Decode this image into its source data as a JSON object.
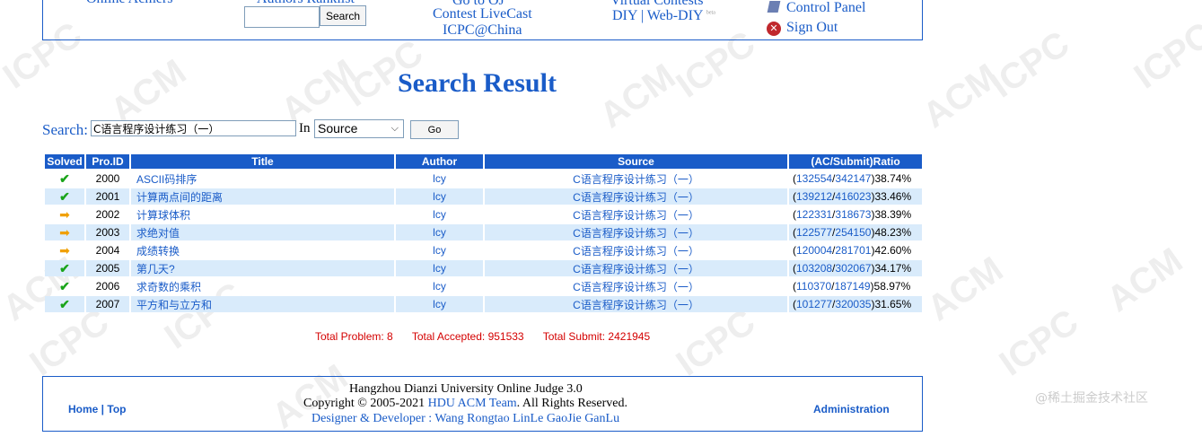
{
  "header": {
    "online_members": "Online Acmers",
    "authors_ranklist": "Authors Ranklist",
    "search_button": "Search",
    "go_to_oj": "Go to OJ",
    "contest_livecast": "Contest LiveCast",
    "icpc_china": "ICPC@China",
    "virtual_contests": "Virtual Contests",
    "diy": "DIY",
    "web_diy": "Web-DIY",
    "beta": "beta",
    "control_panel": "Control Panel",
    "sign_out": "Sign Out"
  },
  "page_title": "Search Result",
  "search": {
    "label": "Search:",
    "value": "C语言程序设计练习（一）",
    "in_label": "In",
    "field_selected": "Source",
    "go_button": "Go"
  },
  "table": {
    "columns": [
      "Solved",
      "Pro.ID",
      "Title",
      "Author",
      "Source",
      "(AC/Submit)Ratio"
    ],
    "rows": [
      {
        "status": "solved",
        "id": "2000",
        "title": "ASCII码排序",
        "author": "lcy",
        "source": "C语言程序设计练习（一）",
        "ac": "132554",
        "submit": "342147",
        "ratio": "38.74%"
      },
      {
        "status": "solved",
        "id": "2001",
        "title": "计算两点间的距离",
        "author": "lcy",
        "source": "C语言程序设计练习（一）",
        "ac": "139212",
        "submit": "416023",
        "ratio": "33.46%"
      },
      {
        "status": "attempted",
        "id": "2002",
        "title": "计算球体积",
        "author": "lcy",
        "source": "C语言程序设计练习（一）",
        "ac": "122331",
        "submit": "318673",
        "ratio": "38.39%"
      },
      {
        "status": "attempted",
        "id": "2003",
        "title": "求绝对值",
        "author": "lcy",
        "source": "C语言程序设计练习（一）",
        "ac": "122577",
        "submit": "254150",
        "ratio": "48.23%"
      },
      {
        "status": "attempted",
        "id": "2004",
        "title": "成绩转换",
        "author": "lcy",
        "source": "C语言程序设计练习（一）",
        "ac": "120004",
        "submit": "281701",
        "ratio": "42.60%"
      },
      {
        "status": "solved",
        "id": "2005",
        "title": "第几天?",
        "author": "lcy",
        "source": "C语言程序设计练习（一）",
        "ac": "103208",
        "submit": "302067",
        "ratio": "34.17%"
      },
      {
        "status": "solved",
        "id": "2006",
        "title": "求奇数的乘积",
        "author": "lcy",
        "source": "C语言程序设计练习（一）",
        "ac": "110370",
        "submit": "187149",
        "ratio": "58.97%"
      },
      {
        "status": "solved",
        "id": "2007",
        "title": "平方和与立方和",
        "author": "lcy",
        "source": "C语言程序设计练习（一）",
        "ac": "101277",
        "submit": "320035",
        "ratio": "31.65%"
      }
    ]
  },
  "totals": {
    "problems": "Total Problem: 8",
    "accepted": "Total Accepted: 951533",
    "submit": "Total Submit: 2421945"
  },
  "footer": {
    "home": "Home",
    "top": "Top",
    "line1": "Hangzhou Dianzi University Online Judge 3.0",
    "copyright_prefix": "Copyright © 2005-2021",
    "team": "HDU ACM Team",
    "copyright_suffix": ". All Rights Reserved.",
    "designers": "Designer & Developer : Wang Rongtao LinLe GaoJie GanLu",
    "administration": "Administration"
  },
  "watermark": {
    "text_acm": "ACM",
    "text_icpc": "ICPC",
    "juejin": "@稀土掘金技术社区"
  },
  "colors": {
    "link": "#1a5cc8",
    "header_bg": "#1a5cc8",
    "alt_row": "#d9ebfb",
    "totals": "#d40000"
  }
}
